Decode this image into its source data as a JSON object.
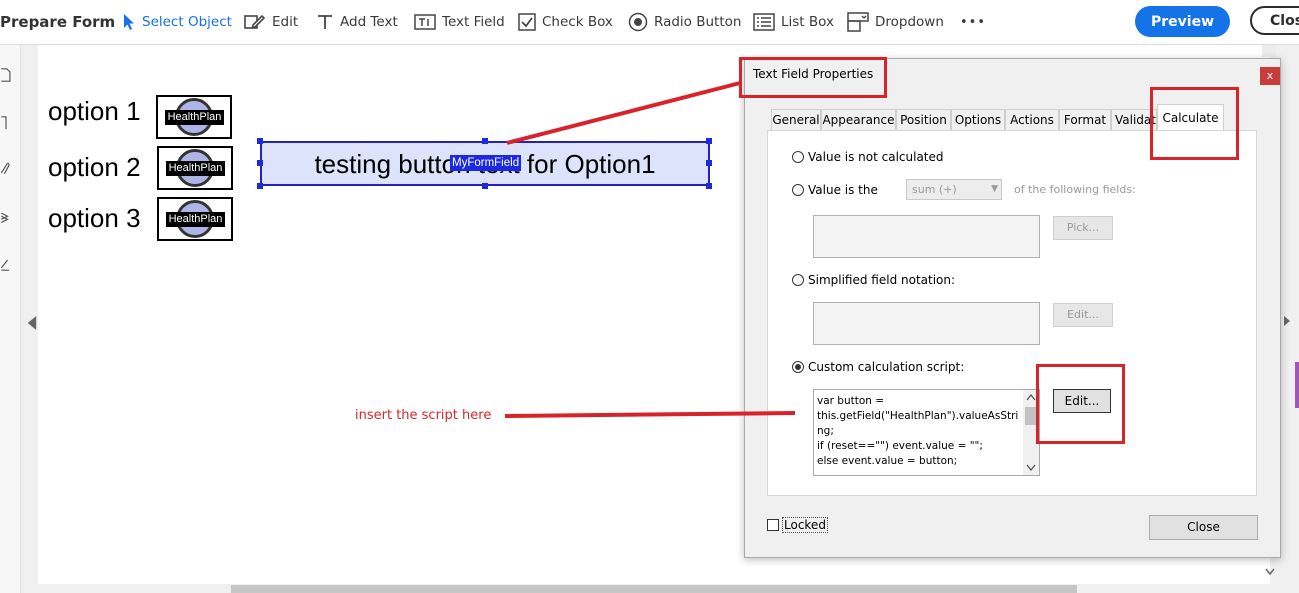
{
  "toolbar": {
    "title": "Prepare Form",
    "tools": {
      "select_object": "Select Object",
      "edit": "Edit",
      "add_text": "Add Text",
      "text_field": "Text Field",
      "check_box": "Check Box",
      "radio_button": "Radio Button",
      "list_box": "List Box",
      "dropdown": "Dropdown"
    },
    "more": "•••",
    "preview": "Preview",
    "close": "Clos"
  },
  "document": {
    "options": [
      {
        "label": "option 1",
        "button_text": "HealthPlan"
      },
      {
        "label": "option 2",
        "button_text": "HealthPlan"
      },
      {
        "label": "option 3",
        "button_text": "HealthPlan"
      }
    ],
    "text_field": {
      "value": "testing button text for Option1",
      "name": "MyFormField"
    },
    "annotation": "insert the script here"
  },
  "dialog": {
    "title": "Text Field Properties",
    "close_x": "x",
    "tabs": [
      "General",
      "Appearance",
      "Position",
      "Options",
      "Actions",
      "Format",
      "Validate",
      "Calculate"
    ],
    "active_tab": "Calculate",
    "radios": {
      "not_calculated": "Value is not calculated",
      "value_is_the": "Value is the",
      "simplified": "Simplified field notation:",
      "custom": "Custom calculation script:"
    },
    "selected_radio": "custom",
    "operation_select": "sum (+)",
    "of_fields": "of the following fields:",
    "pick_button": "Pick...",
    "edit_simplified_button": "Edit...",
    "edit_script_button": "Edit...",
    "script": "var button =\nthis.getField(\"HealthPlan\").valueAsString;\nif (reset==\"\") event.value = \"\";\nelse event.value = button;",
    "locked_label": "Locked",
    "close_button": "Close"
  },
  "colors": {
    "accent": "#1473e6",
    "annotation_red": "#d8232a",
    "field_fill": "#dde3fa",
    "field_border": "#2222c4"
  }
}
